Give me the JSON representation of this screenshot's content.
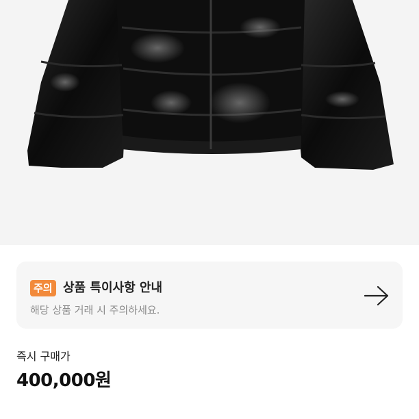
{
  "product": {
    "image_icon": "black-puffer-jacket-image"
  },
  "notice": {
    "badge": "주의",
    "title": "상품 특이사항 안내",
    "description": "해당 상품 거래 시 주의하세요.",
    "arrow_icon": "arrow-right-icon",
    "badge_color": "#f28a3b"
  },
  "price": {
    "label": "즉시 구매가",
    "value": "400,000원"
  }
}
